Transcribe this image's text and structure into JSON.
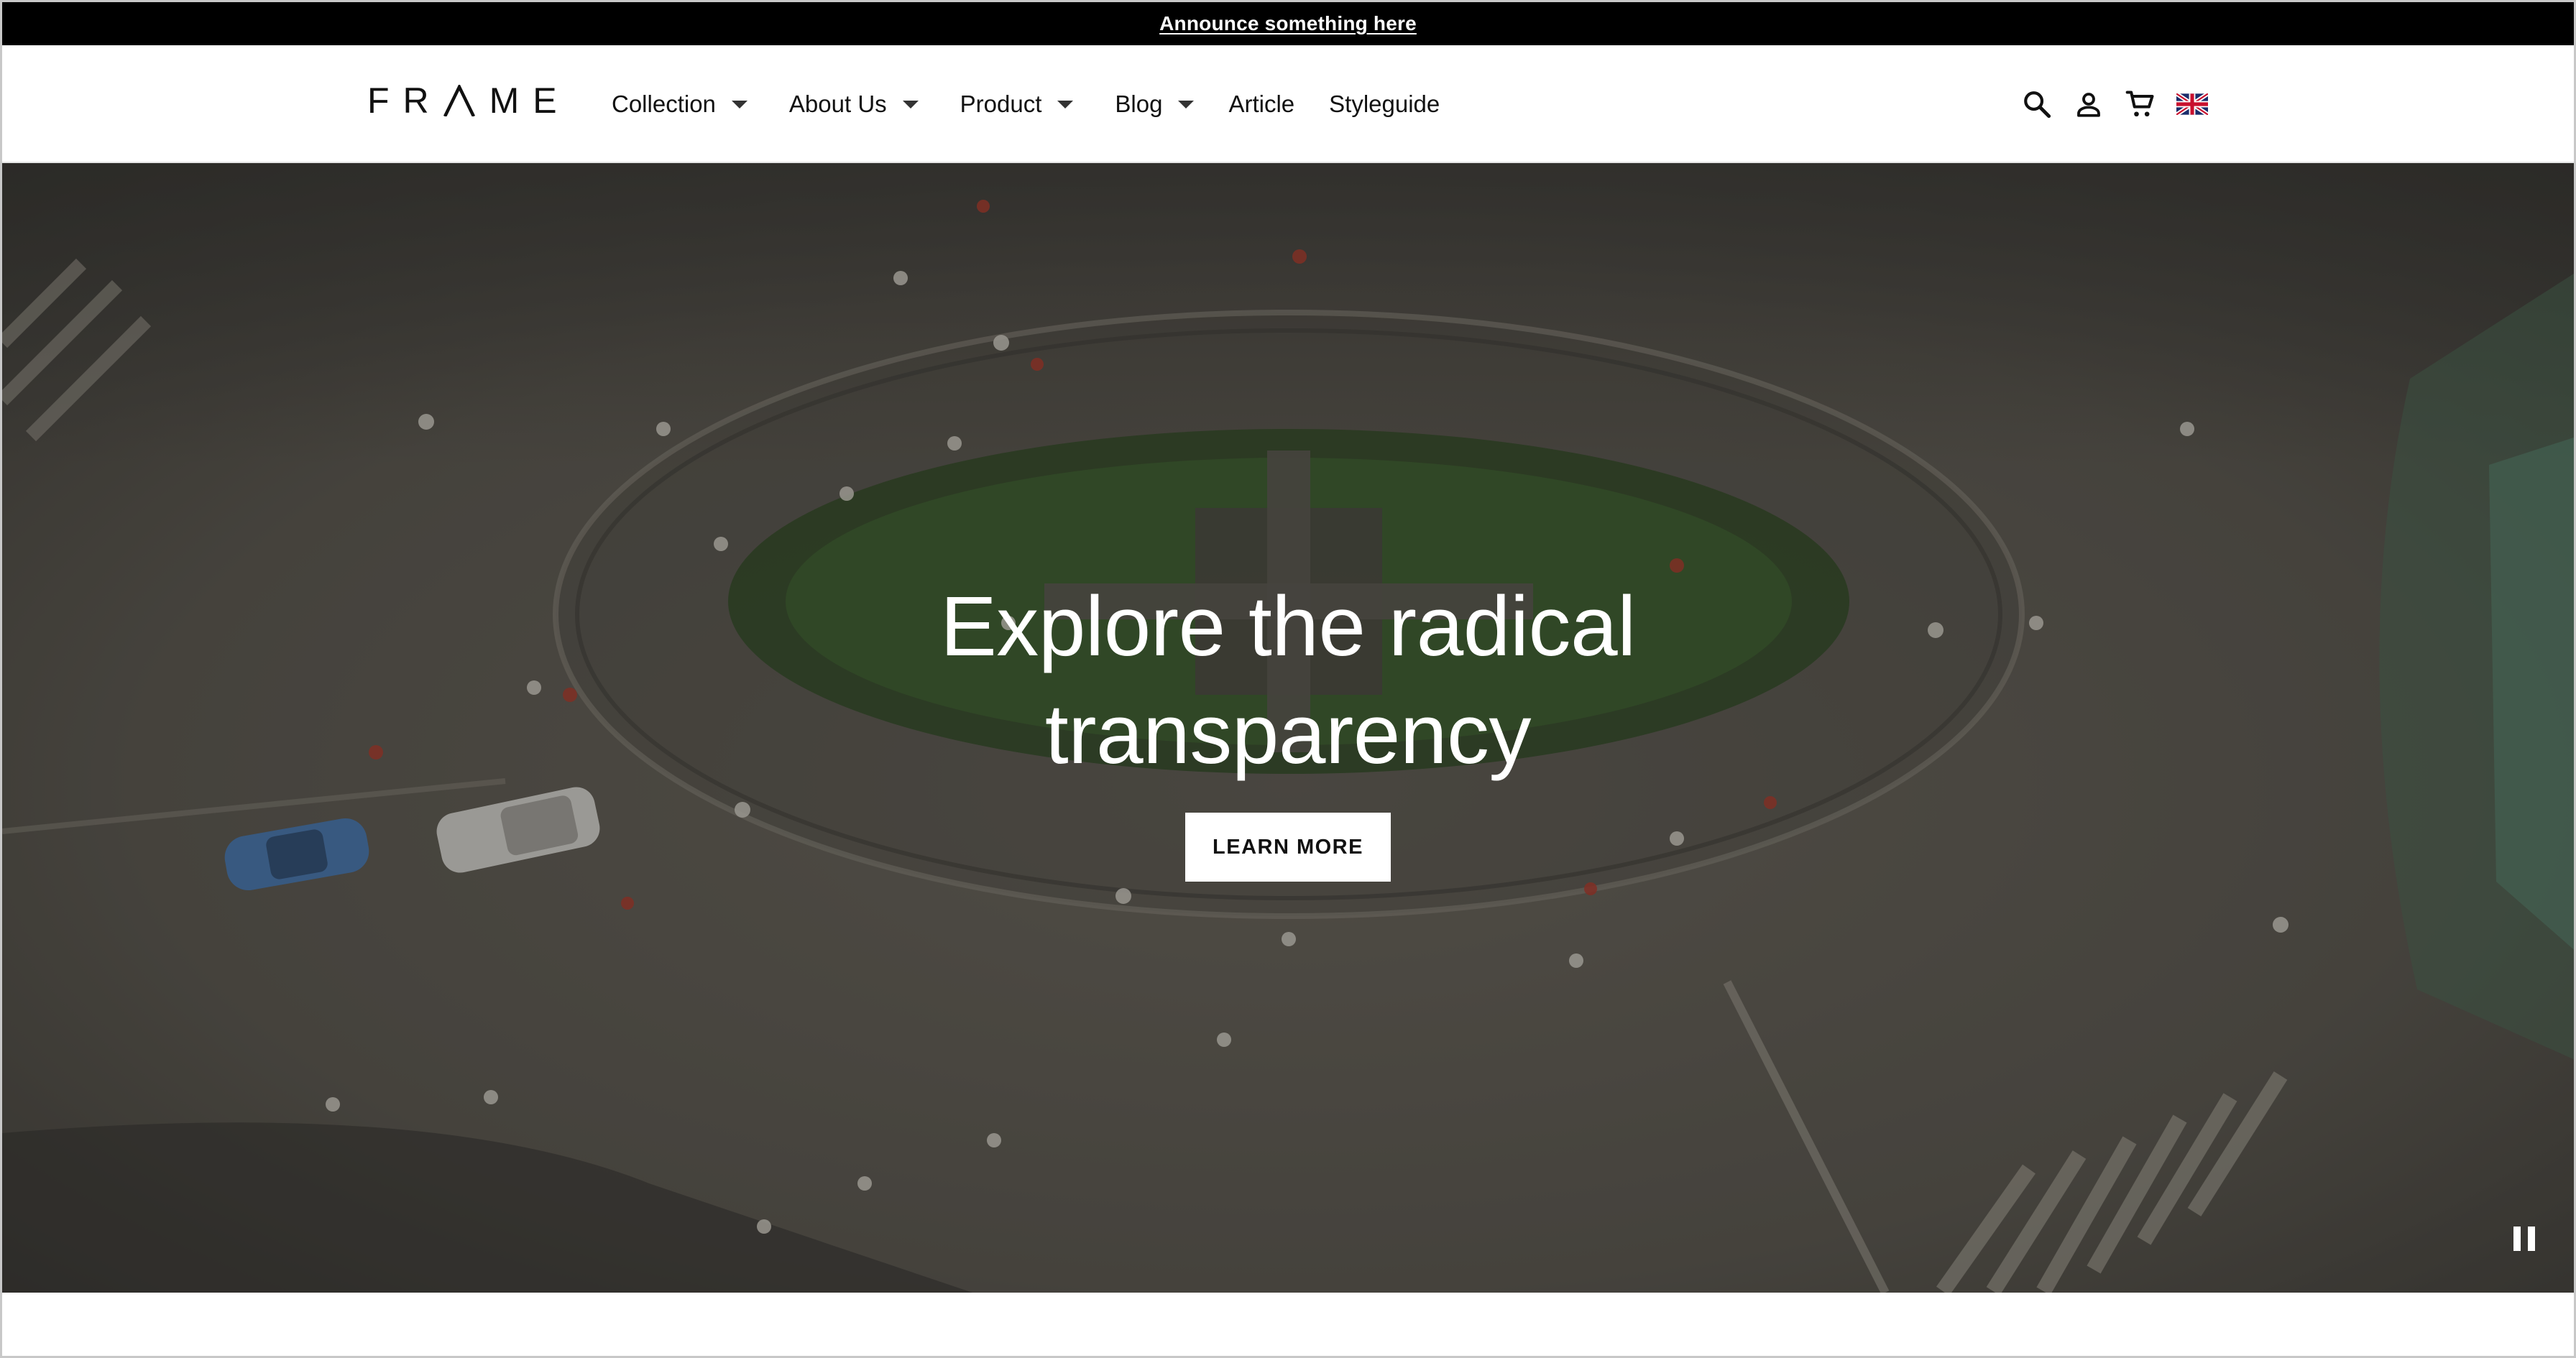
{
  "announcement": {
    "text": "Announce something here"
  },
  "header": {
    "logo_text": "FR ME",
    "nav": [
      {
        "label": "Collection",
        "has_dropdown": true
      },
      {
        "label": "About Us",
        "has_dropdown": true
      },
      {
        "label": "Product",
        "has_dropdown": true
      },
      {
        "label": "Blog",
        "has_dropdown": true
      },
      {
        "label": "Article",
        "has_dropdown": false
      },
      {
        "label": "Styleguide",
        "has_dropdown": false
      }
    ],
    "icons": [
      "search-icon",
      "account-icon",
      "cart-icon",
      "uk-flag-icon"
    ]
  },
  "hero": {
    "title_line1": "Explore the radical",
    "title_line2": "transparency",
    "cta_label": "LEARN MORE",
    "pause_icon": "pause-icon"
  },
  "colors": {
    "announcement_bg": "#000000",
    "announcement_text": "#ffffff",
    "header_bg": "#ffffff",
    "text_primary": "#111111",
    "cta_bg": "#ffffff",
    "hero_overlay": "#3d3a35"
  }
}
